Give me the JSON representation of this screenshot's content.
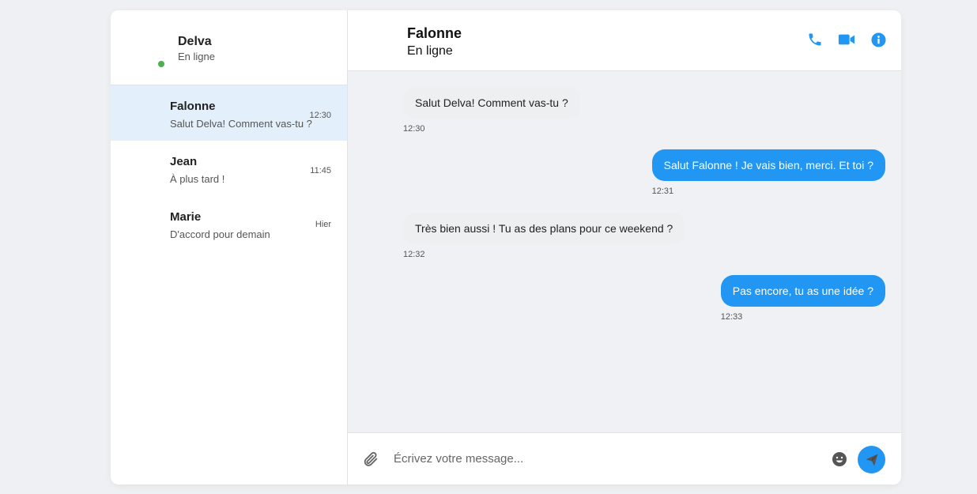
{
  "colors": {
    "accent": "#2196f3",
    "online": "#4caf50",
    "active_row": "#e3f0fb",
    "background": "#eff0f3"
  },
  "me": {
    "name": "Delva",
    "status": "En ligne"
  },
  "conversations": [
    {
      "name": "Falonne",
      "preview": "Salut Delva! Comment vas-tu ?",
      "time": "12:30",
      "active": true
    },
    {
      "name": "Jean",
      "preview": "À plus tard !",
      "time": "11:45",
      "active": false
    },
    {
      "name": "Marie",
      "preview": "D'accord pour demain",
      "time": "Hier",
      "active": false
    }
  ],
  "chat": {
    "contact_name": "Falonne",
    "contact_status": "En ligne",
    "actions": [
      "phone-icon",
      "video-icon",
      "info-icon"
    ]
  },
  "messages": [
    {
      "direction": "received",
      "text": "Salut Delva! Comment vas-tu ?",
      "time": "12:30"
    },
    {
      "direction": "sent",
      "text": "Salut Falonne ! Je vais bien, merci. Et toi ?",
      "time": "12:31"
    },
    {
      "direction": "received",
      "text": "Très bien aussi ! Tu as des plans pour ce weekend ?",
      "time": "12:32"
    },
    {
      "direction": "sent",
      "text": "Pas encore, tu as une idée ?",
      "time": "12:33"
    }
  ],
  "composer": {
    "placeholder": "Écrivez votre message...",
    "value": ""
  }
}
